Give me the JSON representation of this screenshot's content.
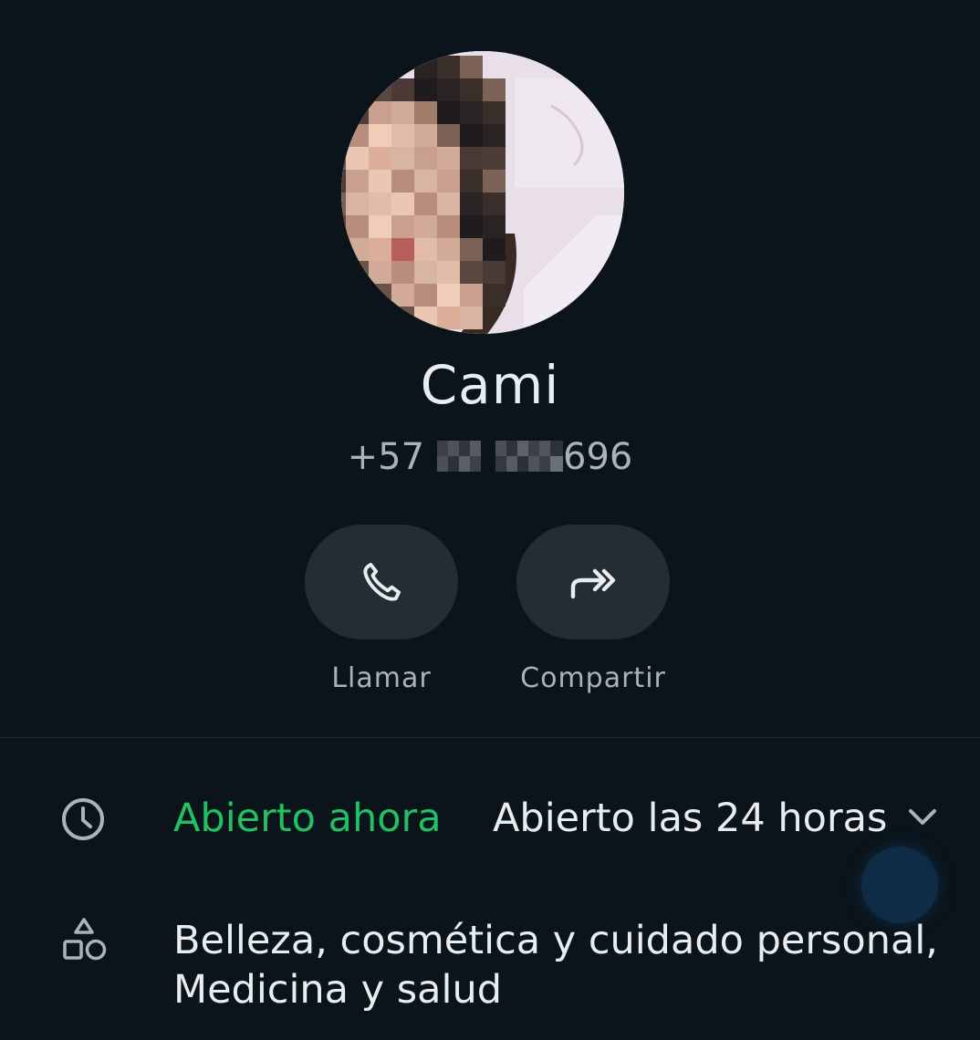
{
  "contact": {
    "name": "Cami",
    "phone_prefix": "+57",
    "phone_suffix": "696"
  },
  "actions": {
    "call_label": "Llamar",
    "share_label": "Compartir"
  },
  "hours": {
    "status": "Abierto ahora",
    "schedule": "Abierto las 24 horas"
  },
  "category": {
    "line1": "Belleza, cosmética y cuidado personal,",
    "line2": "Medicina y salud"
  },
  "icons": {
    "call": "phone-icon",
    "share": "forward-icon",
    "hours": "clock-icon",
    "category": "shapes-icon",
    "expand": "chevron-down-icon"
  },
  "colors": {
    "background": "#0b141a",
    "button_background": "#222d34",
    "open_status": "#21c063",
    "primary_text": "#e9edef",
    "secondary_text": "#aab3b9"
  }
}
